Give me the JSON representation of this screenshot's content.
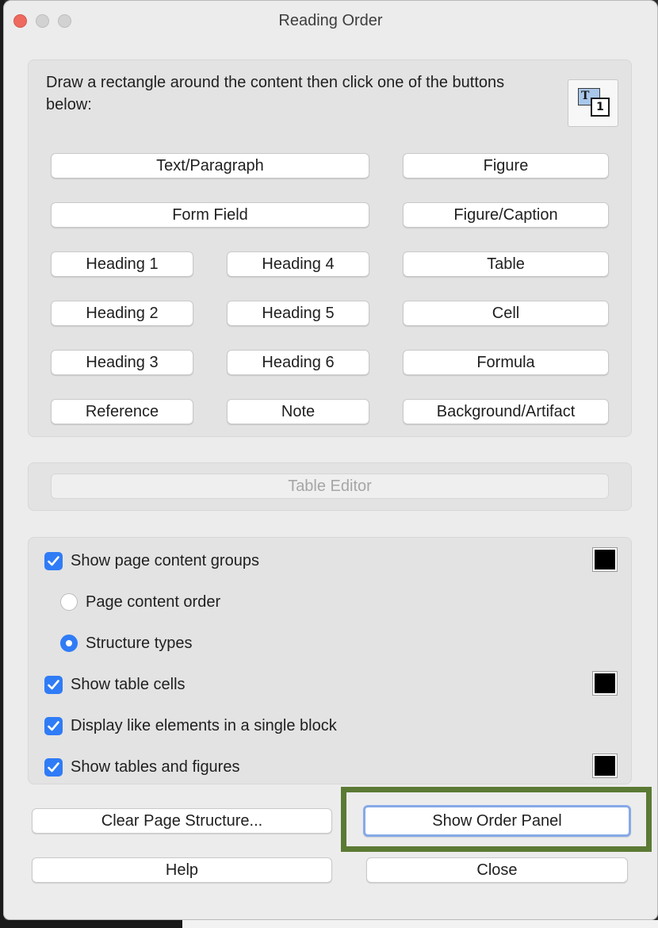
{
  "window": {
    "title": "Reading Order"
  },
  "content_group": {
    "instruction": "Draw a rectangle around the content then click one of the buttons below:",
    "icon": "reading-order-tool-icon",
    "buttons": {
      "text_paragraph": "Text/Paragraph",
      "figure": "Figure",
      "form_field": "Form Field",
      "figure_caption": "Figure/Caption",
      "heading1": "Heading 1",
      "heading4": "Heading 4",
      "table": "Table",
      "heading2": "Heading 2",
      "heading5": "Heading 5",
      "cell": "Cell",
      "heading3": "Heading 3",
      "heading6": "Heading 6",
      "formula": "Formula",
      "reference": "Reference",
      "note": "Note",
      "background_artifact": "Background/Artifact"
    }
  },
  "table_editor": {
    "label": "Table Editor",
    "enabled": false
  },
  "options": {
    "show_page_content_groups": {
      "label": "Show page content groups",
      "checked": true,
      "color": "#000000"
    },
    "page_content_order": {
      "label": "Page content order",
      "selected": false
    },
    "structure_types": {
      "label": "Structure types",
      "selected": true
    },
    "show_table_cells": {
      "label": "Show table cells",
      "checked": true,
      "color": "#000000"
    },
    "display_like_elements": {
      "label": "Display like elements in a single block",
      "checked": true
    },
    "show_tables_and_figures": {
      "label": "Show tables and figures",
      "checked": true,
      "color": "#000000"
    }
  },
  "footer": {
    "clear_page_structure": "Clear Page Structure...",
    "show_order_panel": "Show Order Panel",
    "help": "Help",
    "close": "Close"
  },
  "colors": {
    "accent": "#2f7cf6",
    "highlight_frame": "#5b7a34",
    "default_button_ring": "#86a9e8"
  }
}
